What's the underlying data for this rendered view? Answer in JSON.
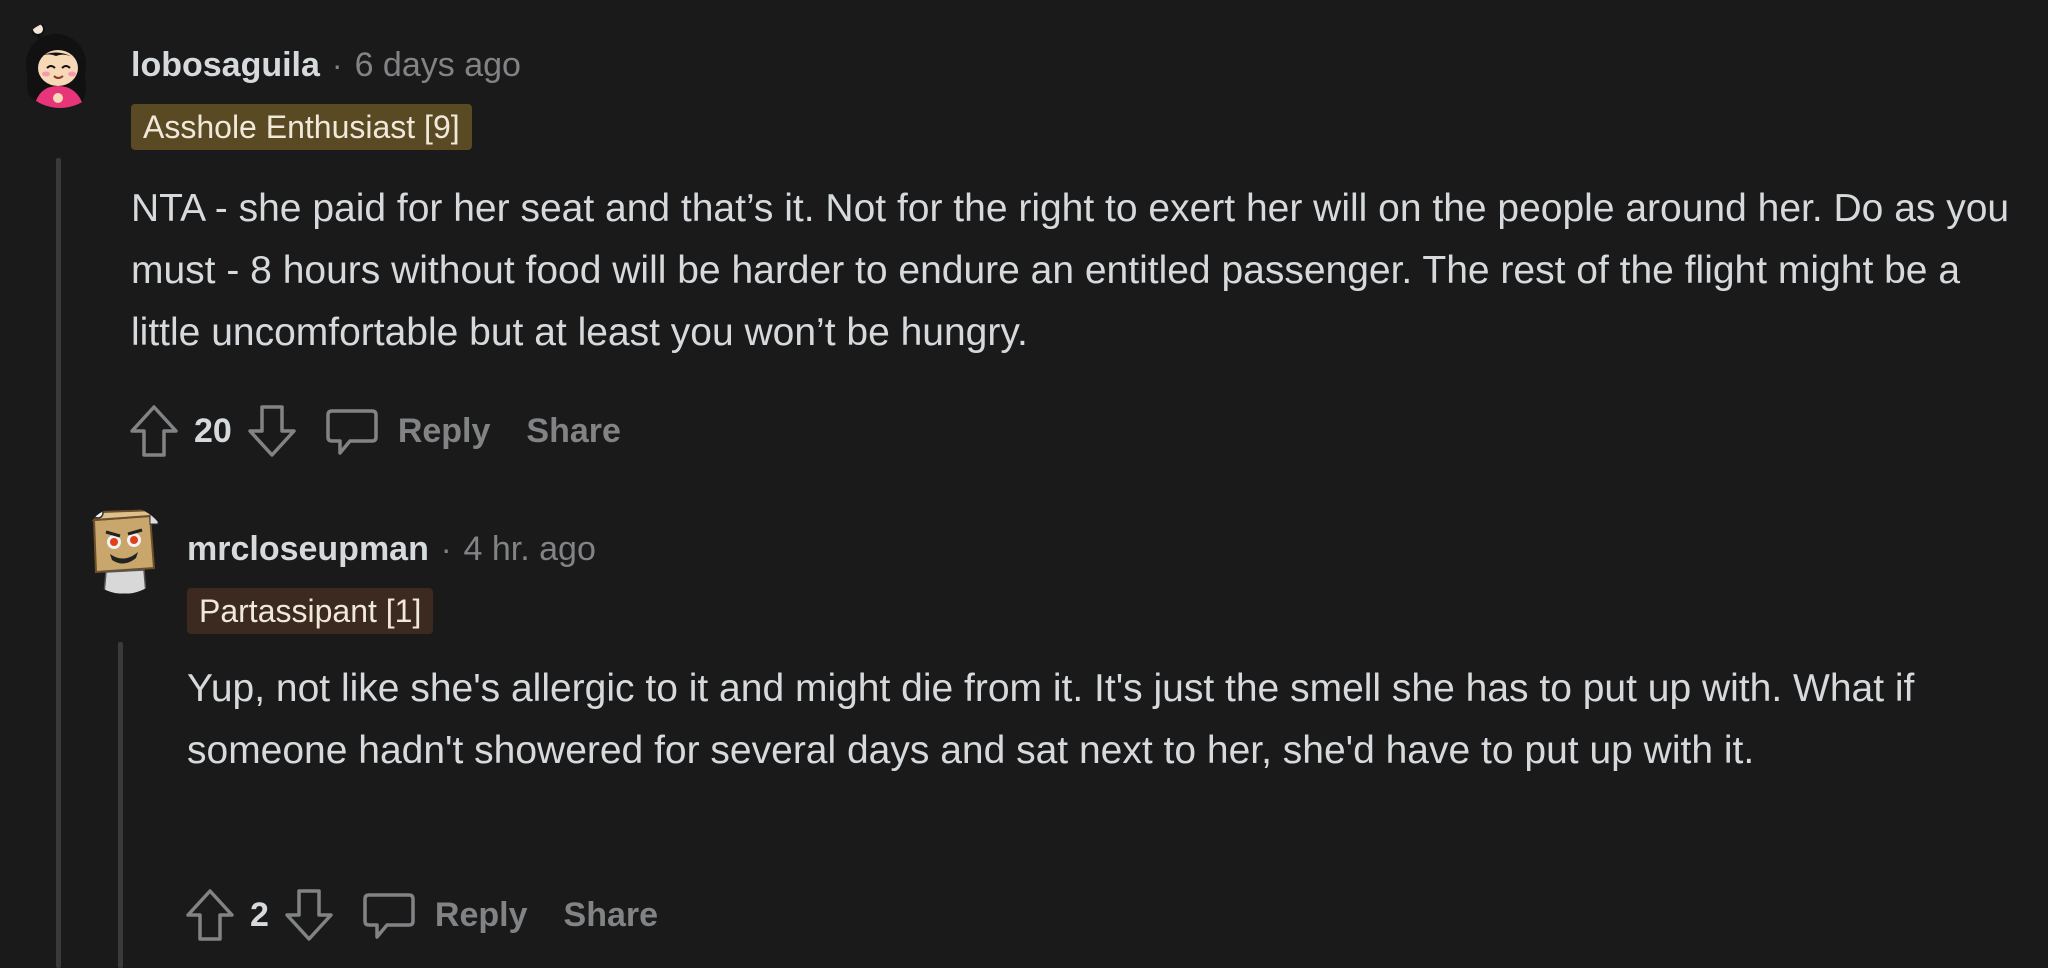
{
  "comments": [
    {
      "username": "lobosaguila",
      "separator": "·",
      "time": "6 days ago",
      "flair": "Asshole Enthusiast [9]",
      "body": "NTA - she paid for her seat and that’s it. Not for the right to exert her will on the people around her. Do as you must - 8 hours without food will be harder to endure an entitled passenger. The rest of the flight might be a little uncomfortable but at least you won’t be hungry.",
      "score": "20",
      "reply_label": "Reply",
      "share_label": "Share",
      "flair_color": "#5a4a24"
    },
    {
      "username": "mrcloseupman",
      "separator": "·",
      "time": "4 hr. ago",
      "flair": "Partassipant [1]",
      "body": "Yup, not like she's allergic to it and might die from it. It's just the smell she has to put up with. What if someone hadn't showered for several days and sat next to her, she'd have to put up with it.",
      "score": "2",
      "reply_label": "Reply",
      "share_label": "Share",
      "flair_color": "#3c2a21"
    }
  ],
  "icons": {
    "upvote": "upvote-arrow-icon",
    "downvote": "downvote-arrow-icon",
    "reply": "speech-bubble-icon"
  },
  "colors": {
    "background": "#1a1a1b",
    "text": "#d7dadc",
    "muted": "#818384",
    "thread_line": "#3a3a3c"
  }
}
